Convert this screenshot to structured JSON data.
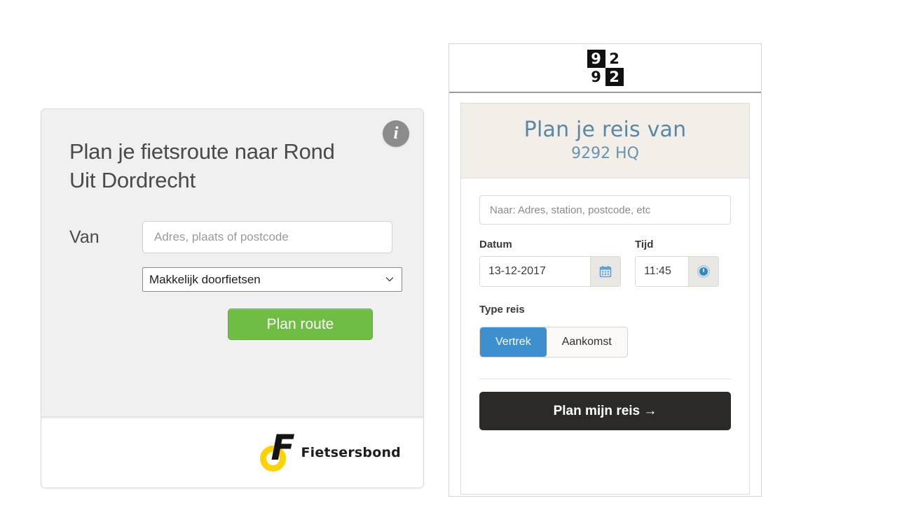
{
  "fietsersbond_widget": {
    "info_icon_label": "i",
    "title": "Plan je fietsroute naar Rond Uit Dordrecht",
    "van_label": "Van",
    "van_input": {
      "value": "",
      "placeholder": "Adres, plaats of postcode"
    },
    "route_select": {
      "selected": "Makkelijk doorfietsen",
      "options": [
        "Makkelijk doorfietsen"
      ]
    },
    "plan_route_label": "Plan route",
    "logo_text": "Fietsersbond",
    "logo_letter": "F",
    "colors": {
      "button_green": "#6fbd45",
      "logo_yellow": "#ffd200",
      "panel_gray": "#f0f0f0",
      "heading_gray": "#4a4a4a"
    }
  },
  "nine292_widget": {
    "logo": {
      "cells": [
        "9",
        "2",
        "9",
        "2"
      ]
    },
    "card_title": "Plan je reis van",
    "card_subtitle": "9292 HQ",
    "naar_input": {
      "value": "",
      "placeholder": "Naar: Adres, station, postcode, etc"
    },
    "datum_label": "Datum",
    "datum_value": "13-12-2017",
    "tijd_label": "Tijd",
    "tijd_value": "11:45",
    "type_reis_label": "Type reis",
    "type_reis_options": [
      "Vertrek",
      "Aankomst"
    ],
    "type_reis_selected": "Vertrek",
    "plan_reis_label": "Plan mijn reis →",
    "colors": {
      "accent_blue": "#3d8fcd",
      "title_blue": "#5c86a4",
      "header_beige": "#f2efe9",
      "cta_black": "#2b2a28"
    }
  }
}
